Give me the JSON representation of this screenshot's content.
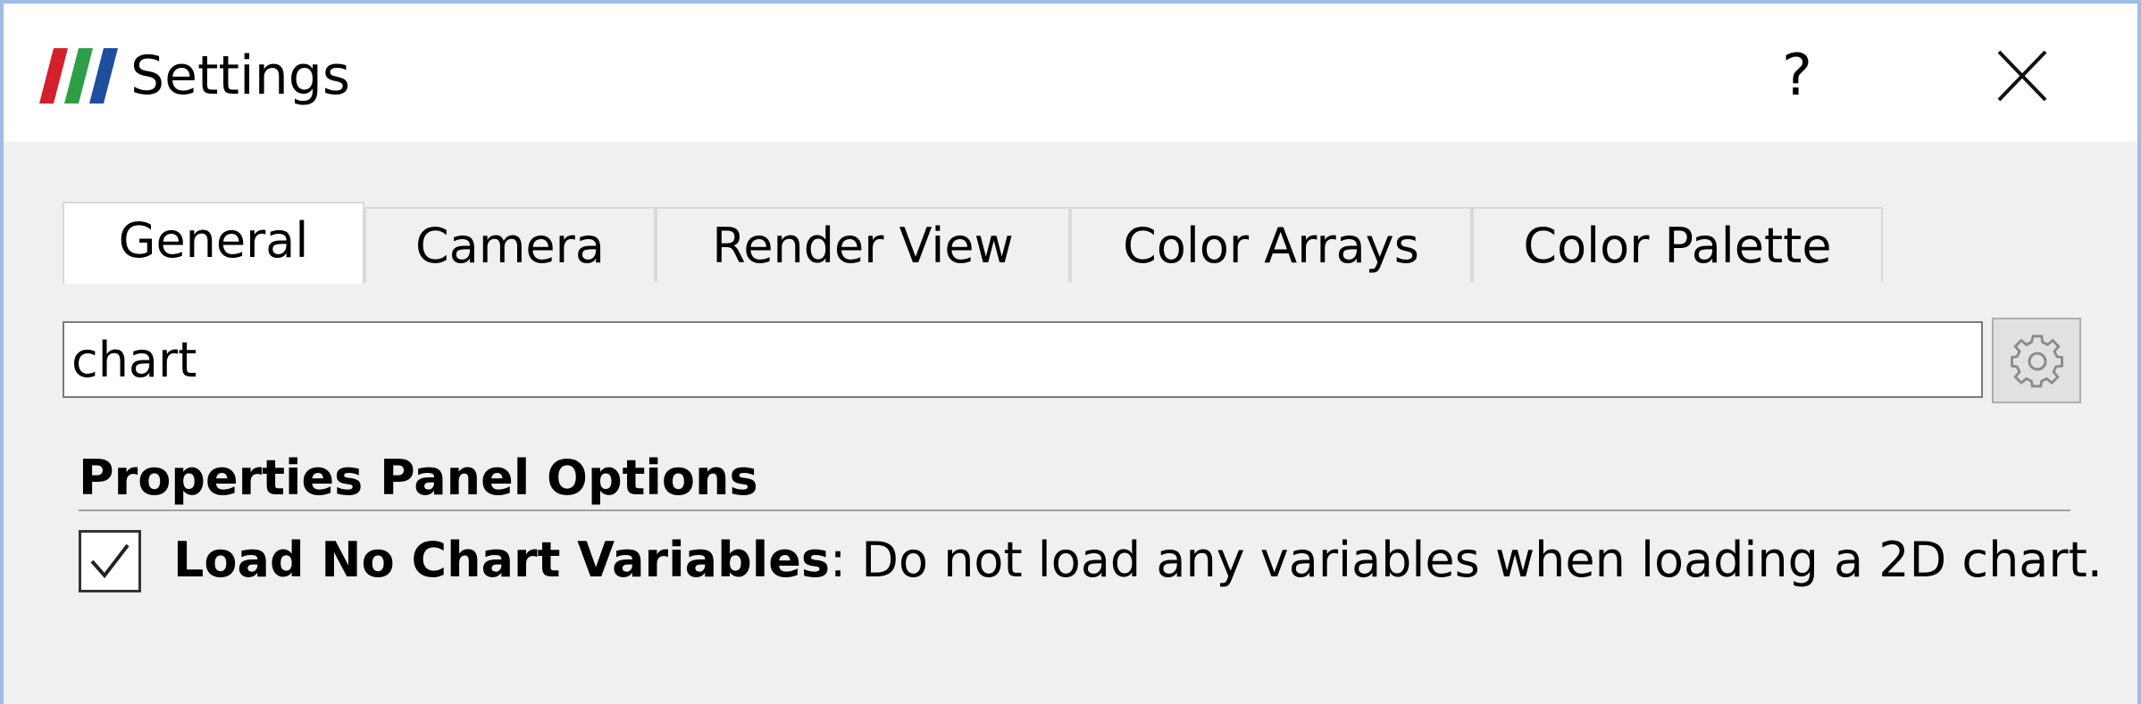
{
  "window": {
    "title": "Settings",
    "logo_icon": "paraview-logo-icon",
    "help_label": "?",
    "close_icon": "close-icon",
    "accent_border": "#9dbde6"
  },
  "tabs": [
    {
      "label": "General",
      "active": true
    },
    {
      "label": "Camera",
      "active": false
    },
    {
      "label": "Render View",
      "active": false
    },
    {
      "label": "Color Arrays",
      "active": false
    },
    {
      "label": "Color Palette",
      "active": false
    }
  ],
  "search": {
    "value": "chart",
    "advanced_icon": "gear-icon"
  },
  "section": {
    "title": "Properties Panel Options"
  },
  "option": {
    "checked": true,
    "label": "Load No Chart Variables",
    "separator": ":",
    "description": " Do not load any variables when loading a 2D chart."
  },
  "colors": {
    "logo_red": "#d3202a",
    "logo_green": "#2e9e47",
    "logo_blue": "#1f4e9e"
  }
}
